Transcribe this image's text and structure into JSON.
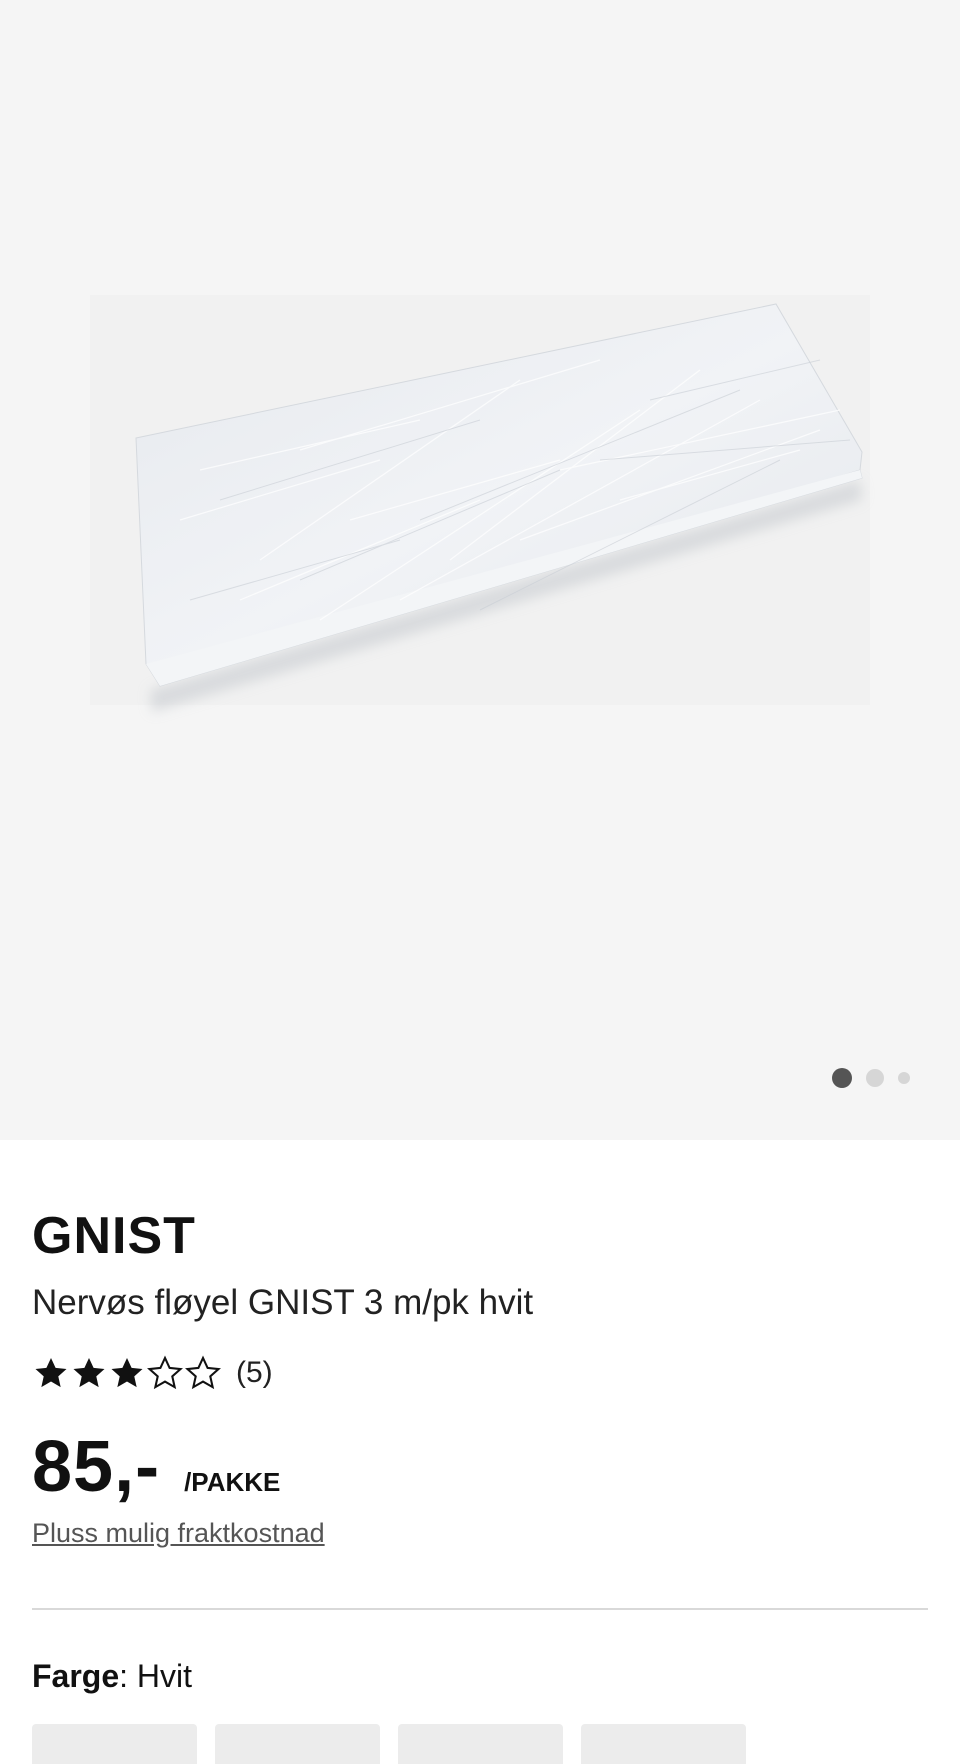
{
  "gallery": {
    "image_alt": "",
    "dots": {
      "count": 3,
      "active_index": 0
    }
  },
  "product": {
    "brand": "GNIST",
    "description": "Nervøs fløyel GNIST 3 m/pk hvit",
    "rating": {
      "value": 3,
      "max": 5,
      "review_count_label": "(5)"
    },
    "price": "85,-",
    "unit": "/PAKKE",
    "shipping_link": "Pluss mulig fraktkostnad",
    "color": {
      "key": "Farge",
      "separator": ": ",
      "value": "Hvit"
    }
  },
  "colors": {
    "star_filled": "#111111",
    "star_empty": "#ffffff",
    "page_bg": "#f5f5f5"
  }
}
